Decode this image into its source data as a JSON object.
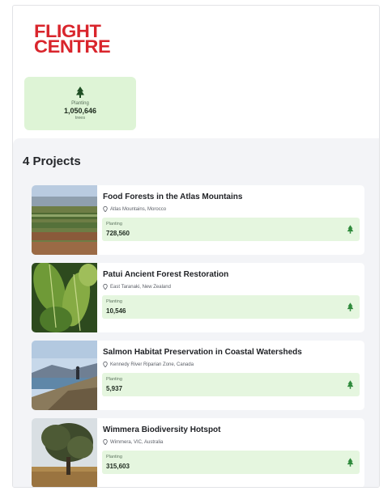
{
  "brand": {
    "logo_line_1": "FLIGHT",
    "logo_line_2": "CENTRE",
    "brand_color": "#d9252c"
  },
  "summary": {
    "icon": "tree-icon",
    "label": "Planting",
    "value": "1,050,646",
    "unit": "trees"
  },
  "projects_section": {
    "title": "4 Projects"
  },
  "projects": [
    {
      "name": "Food Forests in the Atlas Mountains",
      "location": "Atlas Mountains, Morocco",
      "planting_label": "Planting",
      "planting_value": "728,560",
      "thumb": "farm-fields-photo"
    },
    {
      "name": "Patui Ancient Forest Restoration",
      "location": "East Taranaki, New Zealand",
      "planting_label": "Planting",
      "planting_value": "10,546",
      "thumb": "green-leaves-photo"
    },
    {
      "name": "Salmon Habitat Preservation in Coastal Watersheds",
      "location": "Kennedy River Riparian Zone, Canada",
      "planting_label": "Planting",
      "planting_value": "5,937",
      "thumb": "coastal-hiker-photo"
    },
    {
      "name": "Wimmera Biodiversity Hotspot",
      "location": "Wimmera, VIC, Australia",
      "planting_label": "Planting",
      "planting_value": "315,603",
      "thumb": "lone-tree-photo"
    }
  ],
  "colors": {
    "accent_green": "#2f8a3c",
    "card_green": "#def4d6",
    "panel_bg": "#f3f4f7"
  }
}
